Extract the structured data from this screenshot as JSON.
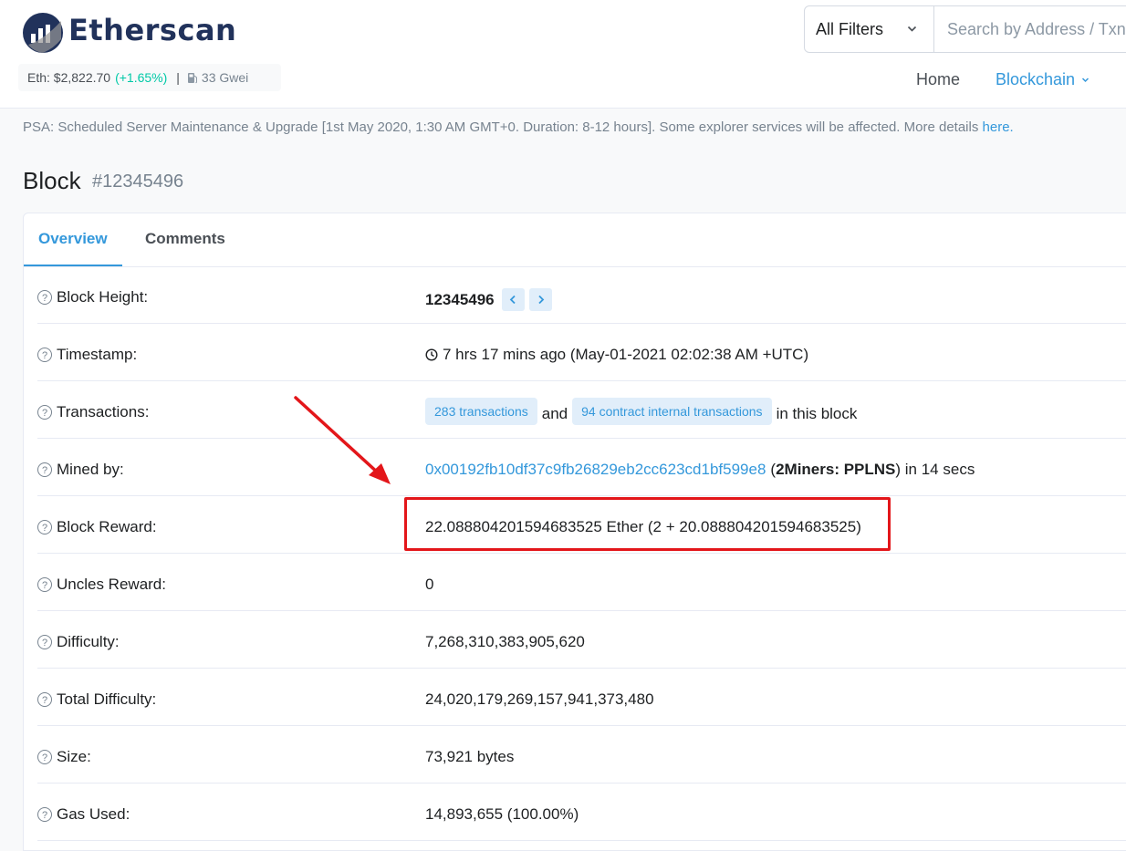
{
  "header": {
    "logo_text": "Etherscan",
    "eth_price_label": "Eth: $2,822.70",
    "eth_price_change": "(+1.65%)",
    "separator": "|",
    "gas_price": "33 Gwei",
    "filter_selected": "All Filters",
    "search_placeholder": "Search by Address / Txn",
    "nav": {
      "home": "Home",
      "blockchain": "Blockchain"
    }
  },
  "psa": {
    "text": "PSA: Scheduled Server Maintenance & Upgrade [1st May 2020, 1:30 AM GMT+0. Duration: 8-12 hours]. Some explorer services will be affected. More details ",
    "link_text": "here."
  },
  "page": {
    "title": "Block",
    "block_number": "#12345496"
  },
  "tabs": {
    "overview": "Overview",
    "comments": "Comments"
  },
  "rows": {
    "block_height": {
      "label": "Block Height:",
      "value": "12345496"
    },
    "timestamp": {
      "label": "Timestamp:",
      "value": "7 hrs 17 mins ago (May-01-2021 02:02:38 AM +UTC)"
    },
    "transactions": {
      "label": "Transactions:",
      "tx_badge": "283 transactions",
      "and": "and",
      "internal_badge": "94 contract internal transactions",
      "suffix": "in this block"
    },
    "mined_by": {
      "label": "Mined by:",
      "address": "0x00192fb10df37c9fb26829eb2cc623cd1bf599e8",
      "open_paren": "(",
      "pool": "2Miners: PPLNS",
      "suffix": ") in 14 secs"
    },
    "block_reward": {
      "label": "Block Reward:",
      "value": "22.088804201594683525 Ether (2 + 20.088804201594683525)"
    },
    "uncles_reward": {
      "label": "Uncles Reward:",
      "value": "0"
    },
    "difficulty": {
      "label": "Difficulty:",
      "value": "7,268,310,383,905,620"
    },
    "total_difficulty": {
      "label": "Total Difficulty:",
      "value": "24,020,179,269,157,941,373,480"
    },
    "size": {
      "label": "Size:",
      "value": "73,921 bytes"
    },
    "gas_used": {
      "label": "Gas Used:",
      "value": "14,893,655 (100.00%)"
    }
  },
  "icons": {
    "help": "question-circle-icon",
    "clock": "clock-icon",
    "prev": "chevron-left-icon",
    "next": "chevron-right-icon"
  },
  "colors": {
    "brand_navy": "#21325b",
    "link_blue": "#3498db",
    "positive_green": "#00c9a7",
    "annotation_red": "#e3161a"
  }
}
